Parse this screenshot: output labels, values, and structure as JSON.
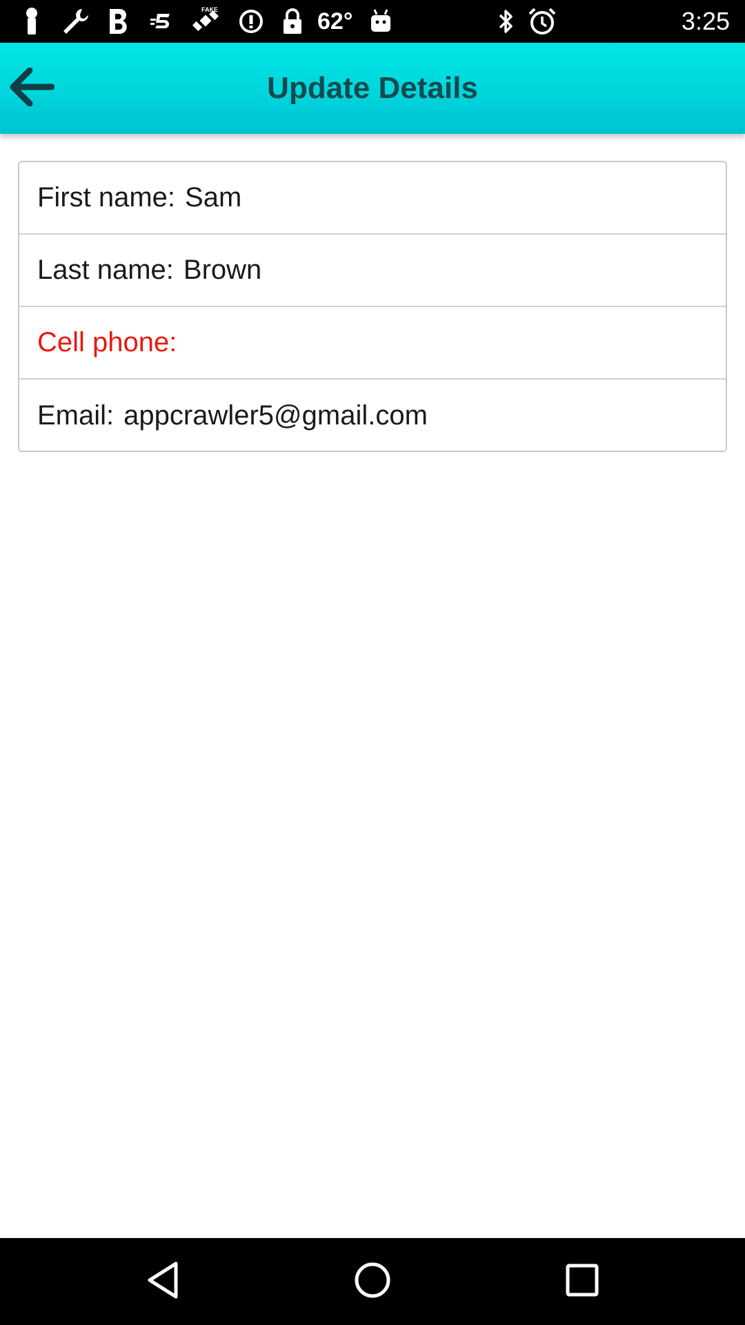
{
  "status_bar": {
    "temperature": "62°",
    "time": "3:25",
    "icons": [
      "notification-pin-icon",
      "wrench-icon",
      "bold-b-icon",
      "fast-five-icon",
      "fake-gps-satellite-icon",
      "info-icon",
      "lock-icon",
      "android-icon",
      "bluetooth-icon",
      "alarm-icon",
      "battery-icon"
    ]
  },
  "app_bar": {
    "title": "Update Details",
    "back_icon": "arrow-back-icon"
  },
  "form": {
    "first_name": {
      "label": "First name:",
      "value": "Sam"
    },
    "last_name": {
      "label": "Last name:",
      "value": "Brown"
    },
    "cell_phone": {
      "label": "Cell phone:",
      "value": ""
    },
    "email": {
      "label": "Email:",
      "value": "appcrawler5@gmail.com"
    }
  },
  "colors": {
    "app_bar": "#00d5dc",
    "title_text": "#14494f",
    "required_label": "#e8190f"
  },
  "nav_bar": {
    "icons": [
      "back-triangle-icon",
      "home-circle-icon",
      "recents-square-icon"
    ]
  }
}
